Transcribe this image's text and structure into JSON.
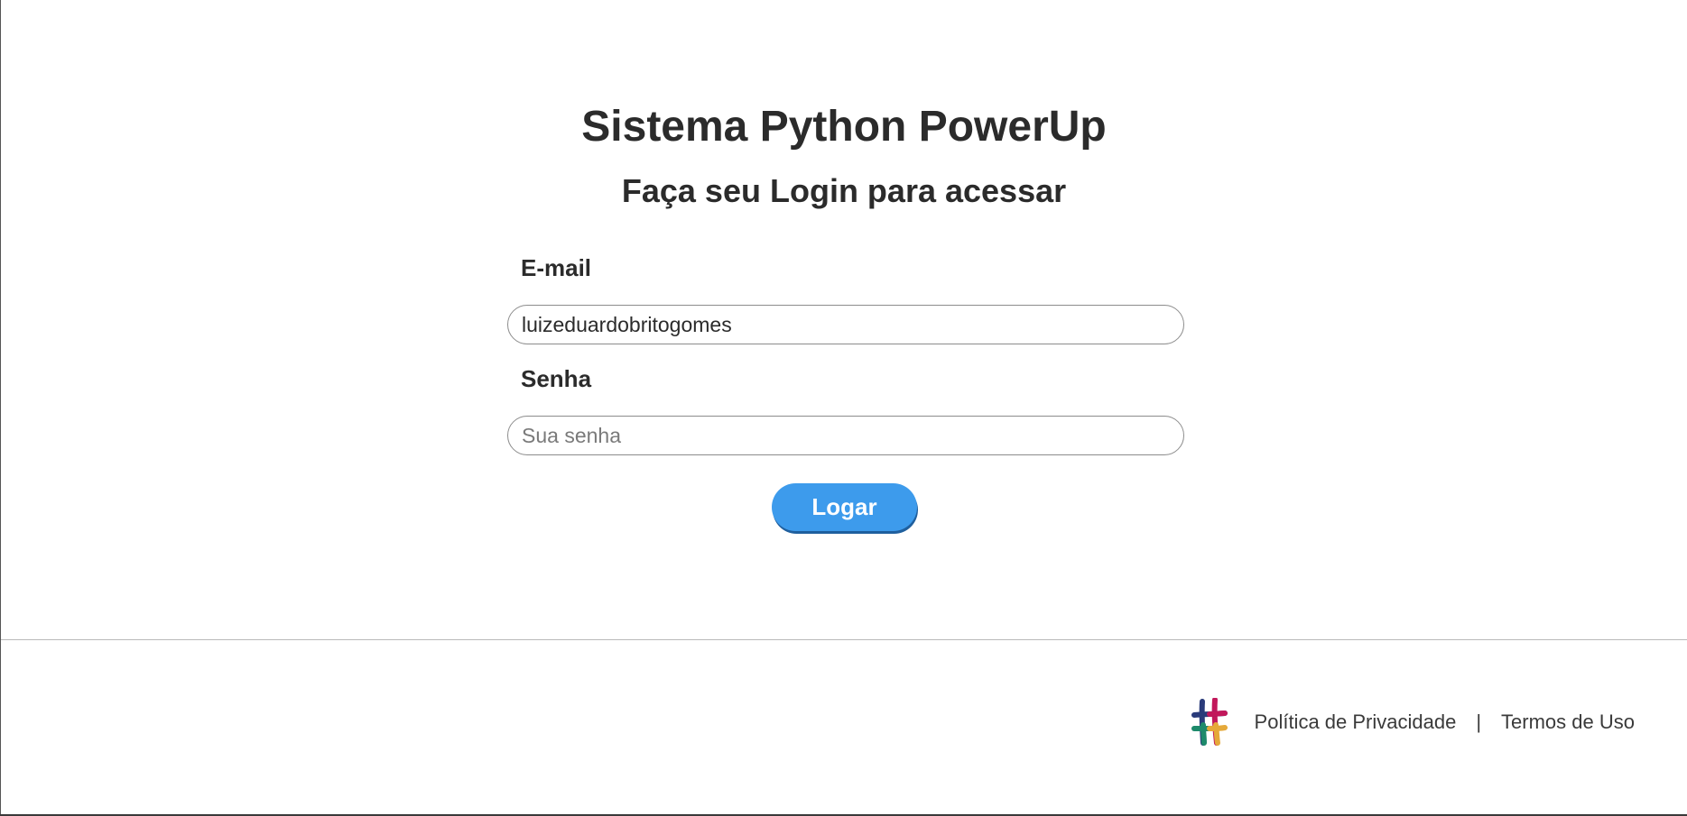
{
  "page": {
    "title": "Sistema Python PowerUp",
    "subtitle": "Faça seu Login para acessar"
  },
  "form": {
    "email_label": "E-mail",
    "email_value": "luizeduardobritogomes",
    "password_label": "Senha",
    "password_placeholder": "Sua senha",
    "submit_label": "Logar"
  },
  "footer": {
    "logo_icon": "hashtag-logo-icon",
    "privacy_link": "Política de Privacidade",
    "separator": "|",
    "terms_link": "Termos de Uso"
  },
  "colors": {
    "button": "#3d9bec",
    "text": "#2b2b2b",
    "logo": [
      "#2a3b7a",
      "#c2185b",
      "#1d8a6b",
      "#e5a93a"
    ]
  }
}
